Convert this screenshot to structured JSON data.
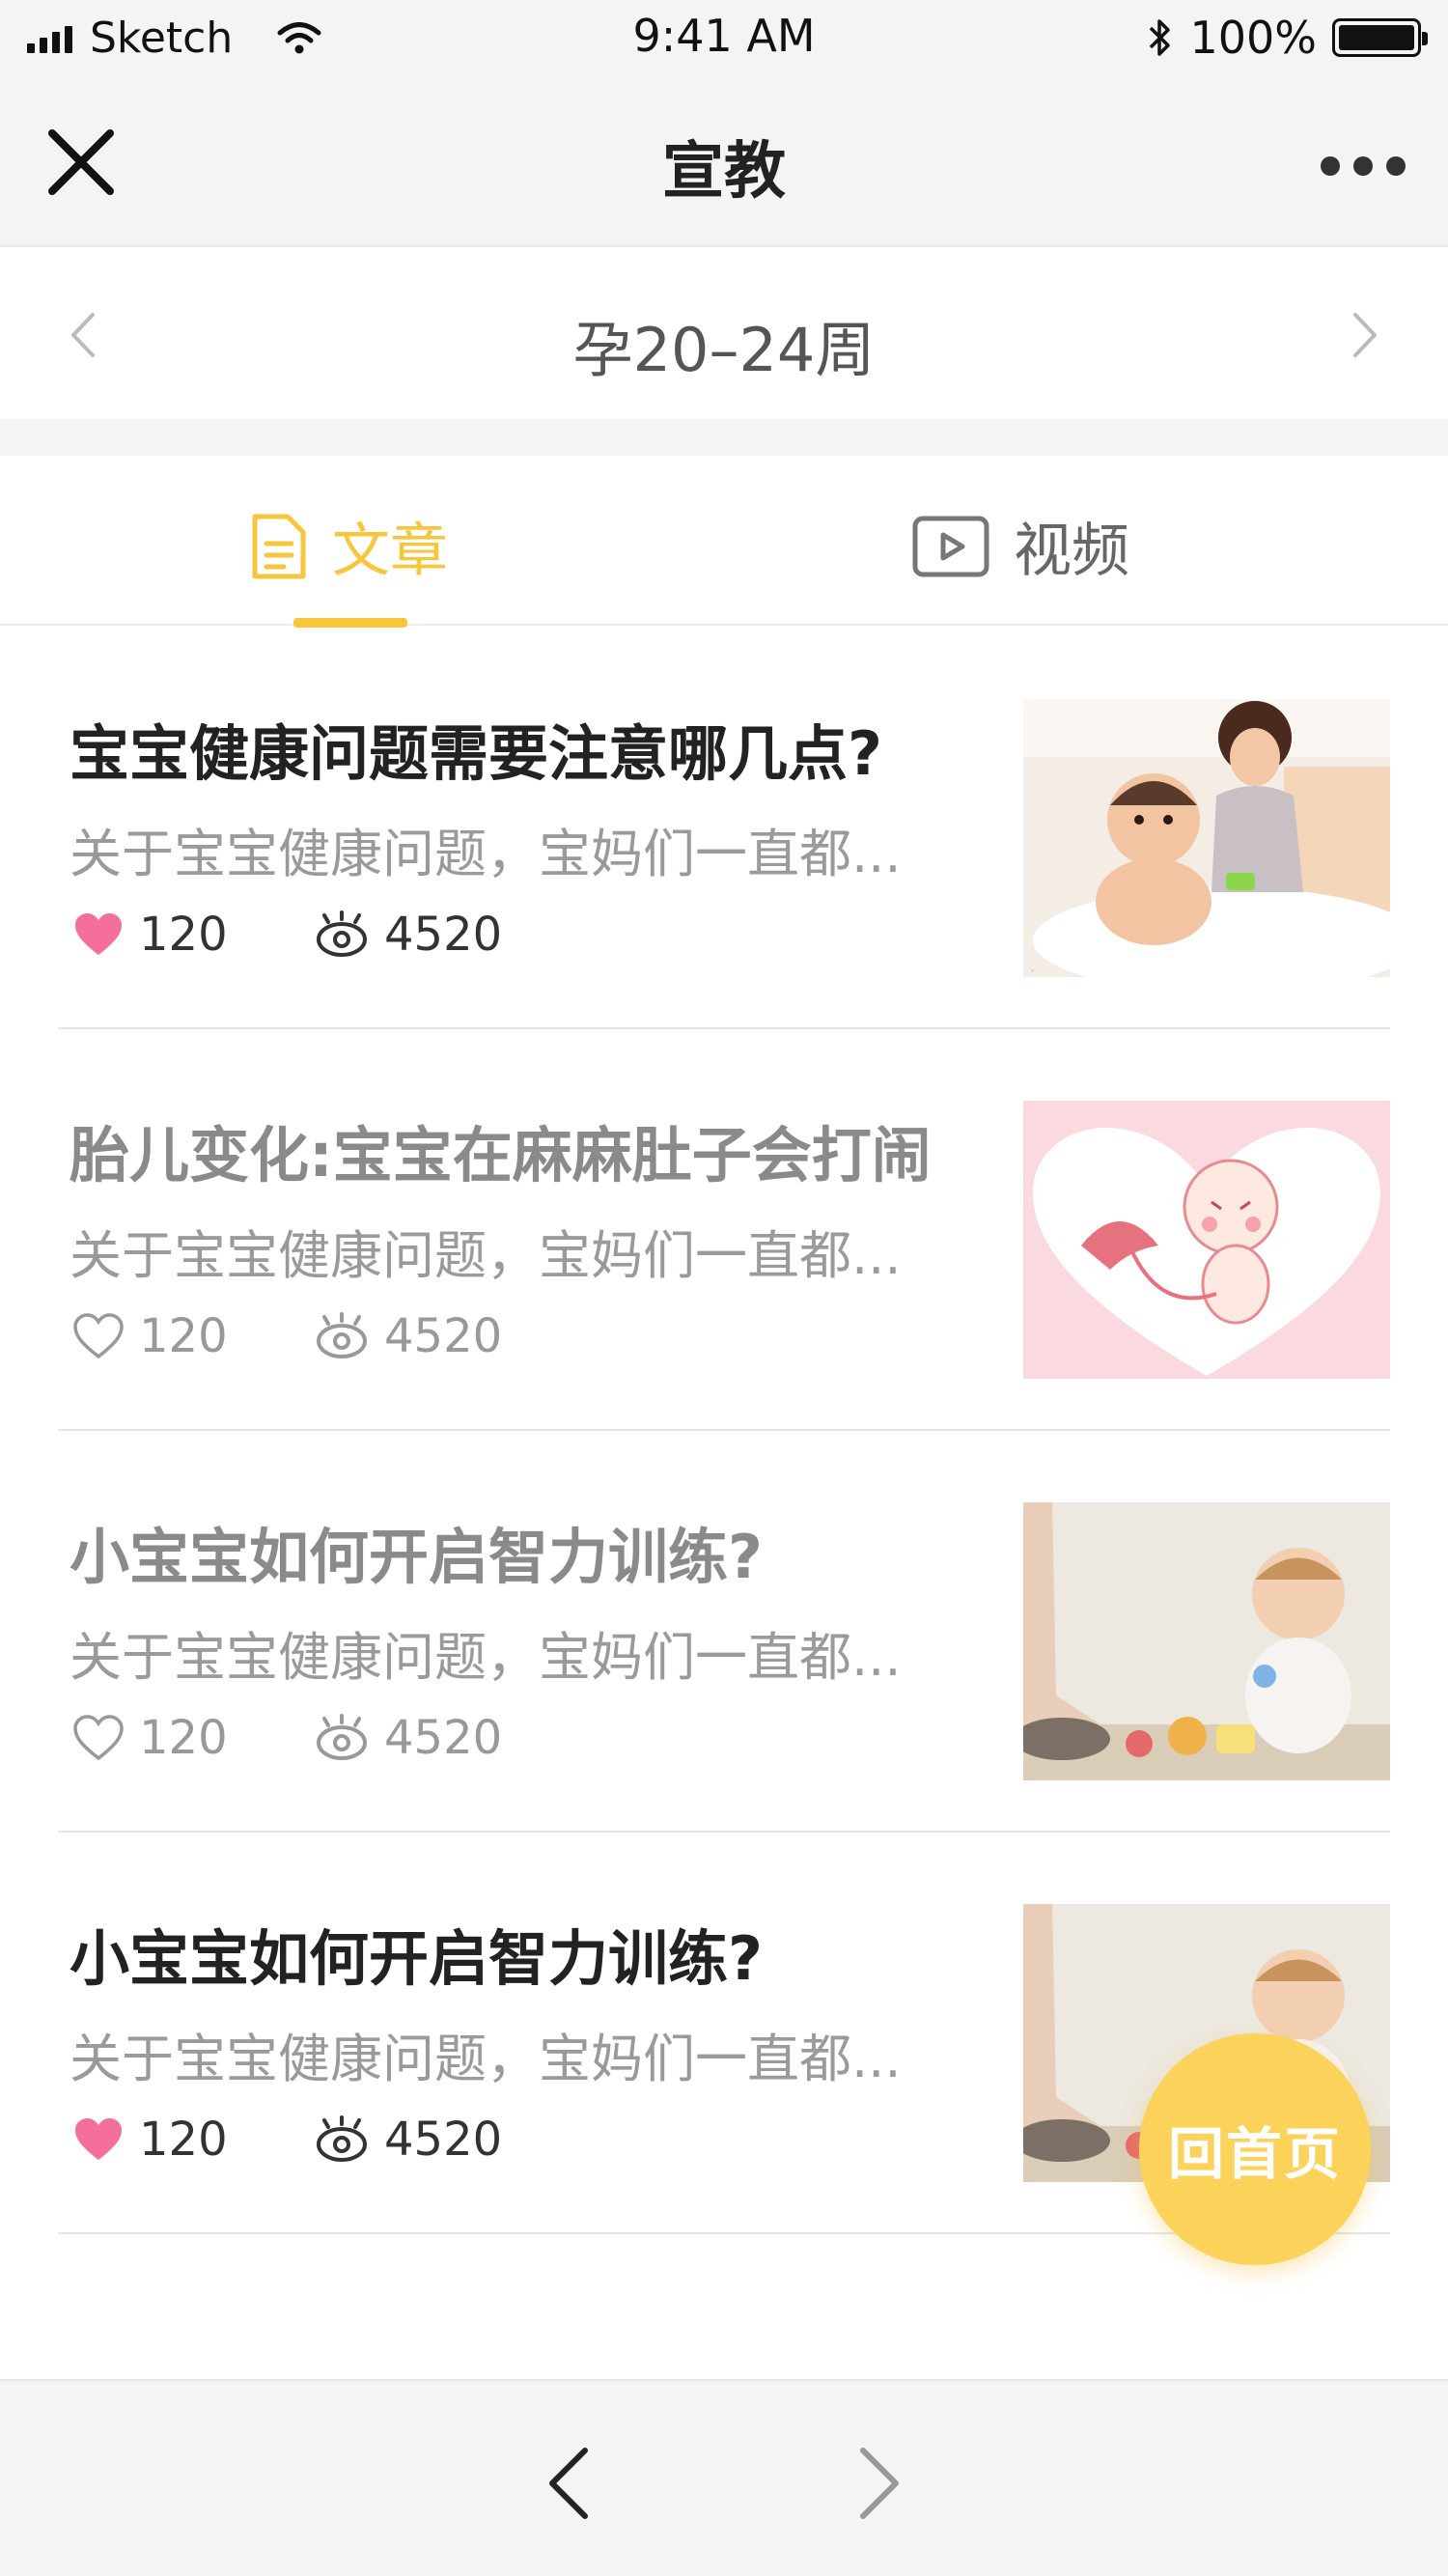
{
  "status_bar": {
    "carrier": "Sketch",
    "time": "9:41 AM",
    "battery": "100%",
    "icons": [
      "signal-icon",
      "wifi-icon",
      "bluetooth-icon",
      "battery-icon"
    ]
  },
  "nav": {
    "title": "宣教",
    "close_icon": "close-icon",
    "more_icon": "more-icon"
  },
  "week_selector": {
    "label": "孕20–24周"
  },
  "tabs": [
    {
      "label": "文章",
      "icon": "document-icon",
      "active": true
    },
    {
      "label": "视频",
      "icon": "video-icon",
      "active": false
    }
  ],
  "articles": [
    {
      "title": "宝宝健康问题需要注意哪几点?",
      "desc": "关于宝宝健康问题，宝妈们一直都...",
      "likes": "120",
      "views": "4520",
      "liked": true,
      "read": false,
      "image": "mother-bathing-baby"
    },
    {
      "title": "胎儿变化:宝宝在麻麻肚子会打闹",
      "desc": "关于宝宝健康问题，宝妈们一直都...",
      "likes": "120",
      "views": "4520",
      "liked": false,
      "read": true,
      "image": "cartoon-fetus-heart"
    },
    {
      "title": "小宝宝如何开启智力训练?",
      "desc": "关于宝宝健康问题，宝妈们一直都...",
      "likes": "120",
      "views": "4520",
      "liked": false,
      "read": true,
      "image": "baby-playing-toys"
    },
    {
      "title": "小宝宝如何开启智力训练?",
      "desc": "关于宝宝健康问题，宝妈们一直都...",
      "likes": "120",
      "views": "4520",
      "liked": true,
      "read": false,
      "image": "baby-playing-toys"
    }
  ],
  "home_button": {
    "label": "回首页"
  },
  "colors": {
    "accent": "#f7c63d",
    "like": "#f56f9a",
    "background": "#f4f4f4"
  }
}
